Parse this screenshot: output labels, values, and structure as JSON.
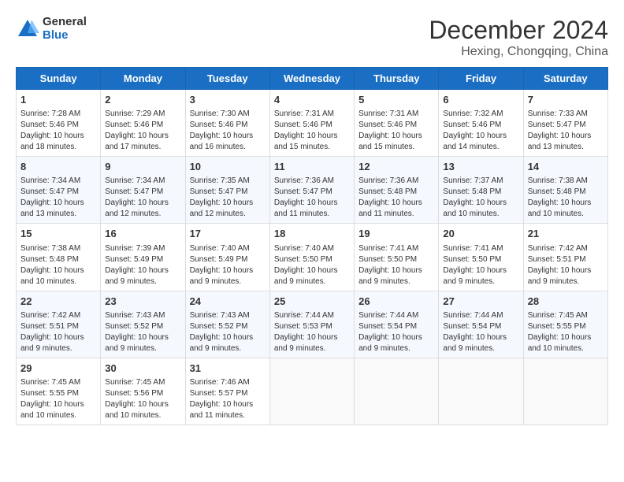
{
  "header": {
    "logo_general": "General",
    "logo_blue": "Blue",
    "main_title": "December 2024",
    "subtitle": "Hexing, Chongqing, China"
  },
  "calendar": {
    "days_of_week": [
      "Sunday",
      "Monday",
      "Tuesday",
      "Wednesday",
      "Thursday",
      "Friday",
      "Saturday"
    ],
    "weeks": [
      [
        {
          "day": "",
          "info": ""
        },
        {
          "day": "2",
          "info": "Sunrise: 7:29 AM\nSunset: 5:46 PM\nDaylight: 10 hours and 17 minutes."
        },
        {
          "day": "3",
          "info": "Sunrise: 7:30 AM\nSunset: 5:46 PM\nDaylight: 10 hours and 16 minutes."
        },
        {
          "day": "4",
          "info": "Sunrise: 7:31 AM\nSunset: 5:46 PM\nDaylight: 10 hours and 15 minutes."
        },
        {
          "day": "5",
          "info": "Sunrise: 7:31 AM\nSunset: 5:46 PM\nDaylight: 10 hours and 15 minutes."
        },
        {
          "day": "6",
          "info": "Sunrise: 7:32 AM\nSunset: 5:46 PM\nDaylight: 10 hours and 14 minutes."
        },
        {
          "day": "7",
          "info": "Sunrise: 7:33 AM\nSunset: 5:47 PM\nDaylight: 10 hours and 13 minutes."
        }
      ],
      [
        {
          "day": "1",
          "info": "Sunrise: 7:28 AM\nSunset: 5:46 PM\nDaylight: 10 hours and 18 minutes."
        },
        null,
        null,
        null,
        null,
        null,
        null
      ],
      [
        {
          "day": "8",
          "info": "Sunrise: 7:34 AM\nSunset: 5:47 PM\nDaylight: 10 hours and 13 minutes."
        },
        {
          "day": "9",
          "info": "Sunrise: 7:34 AM\nSunset: 5:47 PM\nDaylight: 10 hours and 12 minutes."
        },
        {
          "day": "10",
          "info": "Sunrise: 7:35 AM\nSunset: 5:47 PM\nDaylight: 10 hours and 12 minutes."
        },
        {
          "day": "11",
          "info": "Sunrise: 7:36 AM\nSunset: 5:47 PM\nDaylight: 10 hours and 11 minutes."
        },
        {
          "day": "12",
          "info": "Sunrise: 7:36 AM\nSunset: 5:48 PM\nDaylight: 10 hours and 11 minutes."
        },
        {
          "day": "13",
          "info": "Sunrise: 7:37 AM\nSunset: 5:48 PM\nDaylight: 10 hours and 10 minutes."
        },
        {
          "day": "14",
          "info": "Sunrise: 7:38 AM\nSunset: 5:48 PM\nDaylight: 10 hours and 10 minutes."
        }
      ],
      [
        {
          "day": "15",
          "info": "Sunrise: 7:38 AM\nSunset: 5:48 PM\nDaylight: 10 hours and 10 minutes."
        },
        {
          "day": "16",
          "info": "Sunrise: 7:39 AM\nSunset: 5:49 PM\nDaylight: 10 hours and 9 minutes."
        },
        {
          "day": "17",
          "info": "Sunrise: 7:40 AM\nSunset: 5:49 PM\nDaylight: 10 hours and 9 minutes."
        },
        {
          "day": "18",
          "info": "Sunrise: 7:40 AM\nSunset: 5:50 PM\nDaylight: 10 hours and 9 minutes."
        },
        {
          "day": "19",
          "info": "Sunrise: 7:41 AM\nSunset: 5:50 PM\nDaylight: 10 hours and 9 minutes."
        },
        {
          "day": "20",
          "info": "Sunrise: 7:41 AM\nSunset: 5:50 PM\nDaylight: 10 hours and 9 minutes."
        },
        {
          "day": "21",
          "info": "Sunrise: 7:42 AM\nSunset: 5:51 PM\nDaylight: 10 hours and 9 minutes."
        }
      ],
      [
        {
          "day": "22",
          "info": "Sunrise: 7:42 AM\nSunset: 5:51 PM\nDaylight: 10 hours and 9 minutes."
        },
        {
          "day": "23",
          "info": "Sunrise: 7:43 AM\nSunset: 5:52 PM\nDaylight: 10 hours and 9 minutes."
        },
        {
          "day": "24",
          "info": "Sunrise: 7:43 AM\nSunset: 5:52 PM\nDaylight: 10 hours and 9 minutes."
        },
        {
          "day": "25",
          "info": "Sunrise: 7:44 AM\nSunset: 5:53 PM\nDaylight: 10 hours and 9 minutes."
        },
        {
          "day": "26",
          "info": "Sunrise: 7:44 AM\nSunset: 5:54 PM\nDaylight: 10 hours and 9 minutes."
        },
        {
          "day": "27",
          "info": "Sunrise: 7:44 AM\nSunset: 5:54 PM\nDaylight: 10 hours and 9 minutes."
        },
        {
          "day": "28",
          "info": "Sunrise: 7:45 AM\nSunset: 5:55 PM\nDaylight: 10 hours and 10 minutes."
        }
      ],
      [
        {
          "day": "29",
          "info": "Sunrise: 7:45 AM\nSunset: 5:55 PM\nDaylight: 10 hours and 10 minutes."
        },
        {
          "day": "30",
          "info": "Sunrise: 7:45 AM\nSunset: 5:56 PM\nDaylight: 10 hours and 10 minutes."
        },
        {
          "day": "31",
          "info": "Sunrise: 7:46 AM\nSunset: 5:57 PM\nDaylight: 10 hours and 11 minutes."
        },
        {
          "day": "",
          "info": ""
        },
        {
          "day": "",
          "info": ""
        },
        {
          "day": "",
          "info": ""
        },
        {
          "day": "",
          "info": ""
        }
      ]
    ]
  }
}
